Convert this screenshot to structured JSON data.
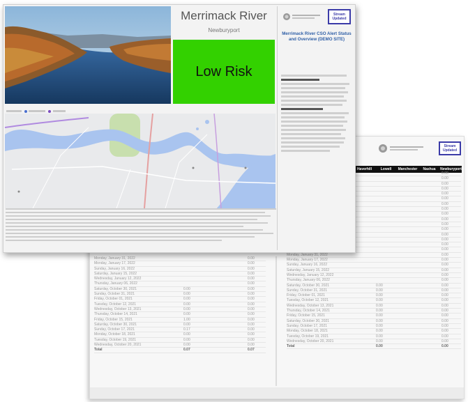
{
  "front": {
    "title": "Merrimack River",
    "subtitle": "Newburyport",
    "risk_label": "Low Risk",
    "risk_color": "#33d100",
    "legend": [
      "map-legend-dot-blue",
      "map-legend-dot-purple"
    ],
    "sidebar_button": "Stream Updated",
    "sidebar_heading": "Merrimack River CSO Alert Status and Overview (DEMO SITE)"
  },
  "back": {
    "button": "Stream Updated",
    "columns": [
      "Haverhill",
      "Lowell",
      "Manchester",
      "Nashua",
      "Newburyport"
    ]
  },
  "table_left": [
    [
      "Monday, January 31, 2022",
      "",
      "0.00"
    ],
    [
      "Monday, January 17, 2022",
      "",
      "0.00"
    ],
    [
      "Sunday, January 16, 2022",
      "",
      "0.00"
    ],
    [
      "Saturday, January 15, 2022",
      "",
      "0.00"
    ],
    [
      "Wednesday, January 12, 2022",
      "",
      "0.00"
    ],
    [
      "Thursday, January 06, 2022",
      "",
      "0.00"
    ],
    [
      "Saturday, October 30, 2021",
      "0.00",
      "0.00"
    ],
    [
      "Sunday, October 31, 2021",
      "0.00",
      "0.00"
    ],
    [
      "Friday, October 01, 2021",
      "0.00",
      "0.00"
    ],
    [
      "Tuesday, October 12, 2021",
      "0.00",
      "0.00"
    ],
    [
      "Wednesday, October 13, 2021",
      "0.00",
      "0.00"
    ],
    [
      "Thursday, October 14, 2021",
      "0.00",
      "0.00"
    ],
    [
      "Friday, October 15, 2021",
      "1.00",
      "0.00"
    ],
    [
      "Saturday, October 30, 2021",
      "0.00",
      "0.00"
    ],
    [
      "Sunday, October 17, 2021",
      "0.17",
      "0.00"
    ],
    [
      "Monday, October 18, 2021",
      "0.00",
      "0.00"
    ],
    [
      "Tuesday, October 19, 2021",
      "0.00",
      "0.00"
    ],
    [
      "Wednesday, October 20, 2021",
      "0.00",
      "0.00"
    ],
    [
      "Total",
      "0.07",
      "0.07"
    ]
  ],
  "table_right": [
    [
      "",
      "",
      "0.00"
    ],
    [
      "",
      "",
      "0.00"
    ],
    [
      "",
      "",
      "0.00"
    ],
    [
      "",
      "",
      "0.00"
    ],
    [
      "",
      "",
      "0.00"
    ],
    [
      "",
      "",
      "0.00"
    ],
    [
      "",
      "",
      "0.00"
    ],
    [
      "",
      "",
      "0.00"
    ],
    [
      "",
      "",
      "0.00"
    ],
    [
      "",
      "",
      "0.00"
    ],
    [
      "",
      "",
      "0.00"
    ],
    [
      "",
      "",
      "0.00"
    ],
    [
      "",
      "",
      "0.00"
    ],
    [
      "",
      "",
      "0.00"
    ],
    [
      "",
      "",
      "0.00"
    ],
    [
      "",
      "",
      "0.00"
    ],
    [
      "Monday, January 31, 2022",
      "",
      "0.00"
    ],
    [
      "Monday, January 17, 2022",
      "",
      "0.00"
    ],
    [
      "Sunday, January 16, 2022",
      "",
      "0.00"
    ],
    [
      "Saturday, January 15, 2022",
      "",
      "0.00"
    ],
    [
      "Wednesday, January 12, 2022",
      "",
      "0.00"
    ],
    [
      "Thursday, January 06, 2022",
      "",
      "0.00"
    ],
    [
      "Saturday, October 30, 2021",
      "0.00",
      "0.00"
    ],
    [
      "Sunday, October 31, 2021",
      "0.00",
      "0.00"
    ],
    [
      "Friday, October 01, 2021",
      "0.00",
      "0.00"
    ],
    [
      "Tuesday, October 12, 2021",
      "0.00",
      "0.00"
    ],
    [
      "Wednesday, October 13, 2021",
      "0.00",
      "0.00"
    ],
    [
      "Thursday, October 14, 2021",
      "0.00",
      "0.00"
    ],
    [
      "Friday, October 15, 2021",
      "0.00",
      "0.00"
    ],
    [
      "Saturday, October 30, 2021",
      "0.00",
      "0.00"
    ],
    [
      "Sunday, October 17, 2021",
      "0.00",
      "0.00"
    ],
    [
      "Monday, October 18, 2021",
      "0.00",
      "0.00"
    ],
    [
      "Tuesday, October 19, 2021",
      "0.00",
      "0.00"
    ],
    [
      "Wednesday, October 20, 2021",
      "0.00",
      "0.00"
    ],
    [
      "Total",
      "0.00",
      "0.00"
    ]
  ]
}
